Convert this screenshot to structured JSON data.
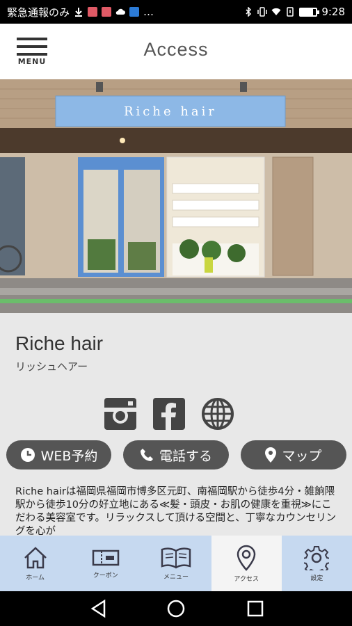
{
  "status_bar": {
    "carrier_text": "緊急通報のみ",
    "more": "…",
    "time": "9:28"
  },
  "header": {
    "menu_label": "MENU",
    "title": "Access"
  },
  "photo": {
    "sign_text": "Riche hair"
  },
  "shop": {
    "name": "Riche hair",
    "kana": "リッシュヘアー"
  },
  "social": {
    "icons": [
      "instagram-icon",
      "facebook-icon",
      "globe-icon"
    ]
  },
  "actions": {
    "web_booking": "WEB予約",
    "call": "電話する",
    "map": "マップ"
  },
  "description": "Riche hairは福岡県福岡市博多区元町、南福岡駅から徒歩4分・雑餉隈駅から徒歩10分の好立地にある≪髪・頭皮・お肌の健康を重視≫にこだわる美容室です。リラックスして頂ける空間と、丁寧なカウンセリングを心が",
  "tabs": [
    {
      "label": "ホーム",
      "icon": "home-icon"
    },
    {
      "label": "クーポン",
      "icon": "coupon-icon"
    },
    {
      "label": "メニュー",
      "icon": "menu-book-icon"
    },
    {
      "label": "アクセス",
      "icon": "map-pin-icon",
      "active": true
    },
    {
      "label": "設定",
      "icon": "gear-icon"
    }
  ],
  "colors": {
    "tab_bar": "#c6d9f0",
    "pill": "#555555",
    "content_bg": "#e8e8e8"
  }
}
